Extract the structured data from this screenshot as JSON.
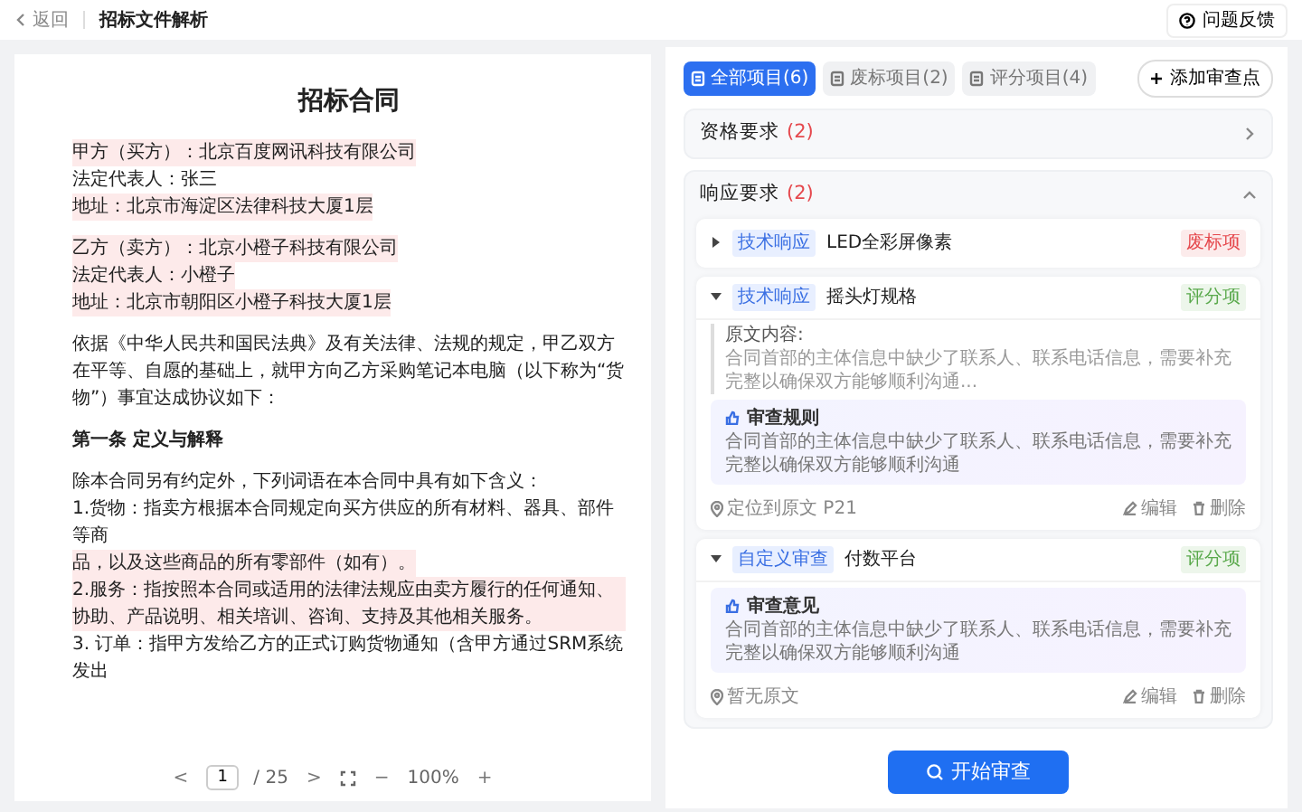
{
  "header": {
    "back": "返回",
    "title": "招标文件解析",
    "feedback": "问题反馈"
  },
  "document": {
    "title": "招标合同",
    "groups": [
      {
        "lines": [
          {
            "kind": "line",
            "text": "甲方（买方）：北京百度网讯科技有限公司",
            "highlighted": true
          },
          {
            "kind": "line",
            "text": "法定代表人：张三",
            "highlighted": false
          },
          {
            "kind": "line",
            "text": "地址：北京市海淀区法律科技大厦1层",
            "highlighted": true
          }
        ]
      },
      {
        "lines": [
          {
            "kind": "line",
            "text": "乙方（卖方）：北京小橙子科技有限公司",
            "highlighted": true
          },
          {
            "kind": "line",
            "text": "法定代表人：小橙子",
            "highlighted": true
          },
          {
            "kind": "line",
            "text": "地址：北京市朝阳区小橙子科技大厦1层",
            "highlighted": true
          }
        ]
      },
      {
        "lines": [
          {
            "kind": "line",
            "text": "依据《中华人民共和国民法典》及有关法律、法规的规定，甲乙双方在平等、自愿的基础上，就甲方向乙方采购笔记本电脑（以下称为“货物”）事宜达成协议如下：",
            "highlighted": false
          }
        ]
      },
      {
        "lines": [
          {
            "kind": "heading",
            "text": "第一条 定义与解释",
            "highlighted": false
          }
        ]
      },
      {
        "lines": [
          {
            "kind": "line",
            "text": "除本合同另有约定外，下列词语在本合同中具有如下含义：",
            "highlighted": false
          },
          {
            "kind": "line",
            "text": "1.货物：指卖方根据本合同规定向买方供应的所有材料、器具、部件等商",
            "highlighted": false
          },
          {
            "kind": "line",
            "text": "品，以及这些商品的所有零部件（如有）。",
            "highlighted": true
          },
          {
            "kind": "line",
            "text": "2.服务：指按照本合同或适用的法律法规应由卖方履行的任何通知、协助、产品说明、相关培训、咨询、支持及其他相关服务。",
            "highlighted": true
          },
          {
            "kind": "line",
            "text": "3. 订单：指甲方发给乙方的正式订购货物通知（含甲方通过SRM系统发出",
            "highlighted": false
          }
        ]
      }
    ]
  },
  "pager": {
    "page": "1",
    "total": "/ 25",
    "zoom": "100%",
    "prev": "<",
    "next": ">",
    "minus": "−",
    "plus": "+"
  },
  "tabs": [
    {
      "label": "全部项目(6)",
      "selected": true
    },
    {
      "label": "废标项目(2)",
      "selected": false
    },
    {
      "label": "评分项目(4)",
      "selected": false
    }
  ],
  "add_button": "添加审查点",
  "sections": [
    {
      "title": "资格要求",
      "count": "(2)",
      "expanded": false
    },
    {
      "title": "响应要求",
      "count": "(2)",
      "expanded": true,
      "items": [
        {
          "tag": "技术响应",
          "title": "LED全彩屏像素",
          "badge": "废标项",
          "color": "#e5484d",
          "expanded": false
        },
        {
          "tag": "技术响应",
          "title": "摇头灯规格",
          "badge": "评分项",
          "color": "#5aa94c",
          "expanded": true,
          "original_label": "原文内容:",
          "original_text": "合同首部的主体信息中缺少了联系人、联系电话信息，需要补充完整以确保双方能够顺利沟通...",
          "box_title": "审查规则",
          "box_text": "合同首部的主体信息中缺少了联系人、联系电话信息，需要补充完整以确保双方能够顺利沟通",
          "locate": "定位到原文 P21",
          "edit": "编辑",
          "delete": "删除"
        },
        {
          "tag": "自定义审查",
          "title": "付数平台",
          "badge": "评分项",
          "color": "#5aa94c",
          "expanded": true,
          "box_title": "审查意见",
          "box_text": "合同首部的主体信息中缺少了联系人、联系电话信息，需要补充完整以确保双方能够顺利沟通",
          "locate": "暂无原文",
          "edit": "编辑",
          "delete": "删除"
        }
      ]
    }
  ],
  "start_button": "开始审查"
}
